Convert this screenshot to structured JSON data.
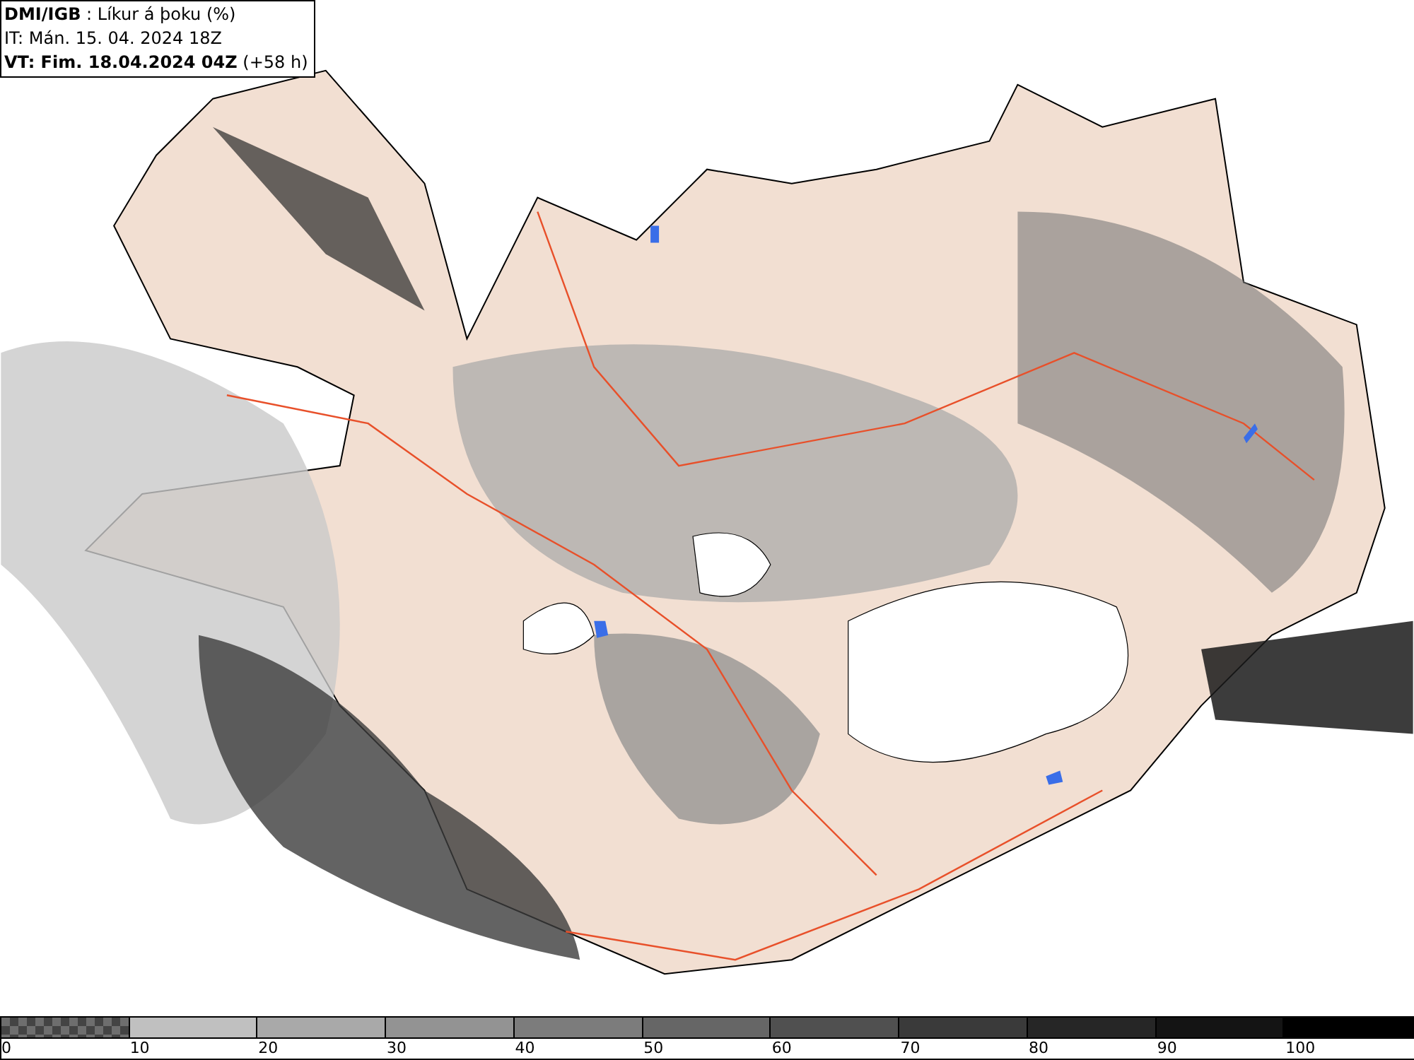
{
  "header": {
    "lines": [
      "**DMI/IGB** : Líkur á þoku (%)",
      "IT: Mán. 15. 04. 2024 18Z",
      "**VT: Fim. 18.04.2024 04Z** (+58 h)"
    ]
  },
  "legend": {
    "bins": [
      {
        "kind": "checker",
        "color": "#6e6e6e"
      },
      {
        "kind": "solid",
        "color": "#c0c0c0"
      },
      {
        "kind": "solid",
        "color": "#a9a9a9"
      },
      {
        "kind": "solid",
        "color": "#939393"
      },
      {
        "kind": "solid",
        "color": "#7c7c7c"
      },
      {
        "kind": "solid",
        "color": "#666666"
      },
      {
        "kind": "solid",
        "color": "#505050"
      },
      {
        "kind": "solid",
        "color": "#3a3a3a"
      },
      {
        "kind": "solid",
        "color": "#262626"
      },
      {
        "kind": "solid",
        "color": "#141414"
      },
      {
        "kind": "solid",
        "color": "#000000"
      }
    ],
    "labels": [
      "0",
      "10",
      "20",
      "30",
      "40",
      "50",
      "60",
      "70",
      "80",
      "90",
      "100"
    ]
  }
}
